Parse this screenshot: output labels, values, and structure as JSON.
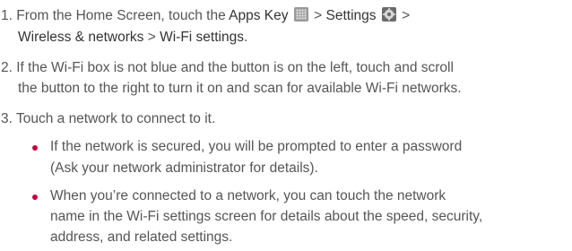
{
  "steps": [
    {
      "number": "1.",
      "line1_pre": "From the Home Screen, touch the ",
      "apps_key": "Apps Key",
      "sep1": " > ",
      "settings": "Settings",
      "sep2": " >",
      "wireless": "Wireless & networks",
      "sep3": " > ",
      "wifi_settings": "Wi-Fi settings",
      "end": "."
    },
    {
      "number": "2.",
      "line1": "If the Wi-Fi box is not blue and the button is on the left, touch and scroll",
      "line2": "the button to the right to turn it on and scan for available Wi-Fi networks."
    },
    {
      "number": "3.",
      "line1": "Touch a network to connect to it."
    }
  ],
  "bullets": [
    {
      "line1": "If the network is secured, you will be prompted to enter a password",
      "line2": "(Ask your network administrator for details)."
    },
    {
      "line1": "When you’re connected to a network, you can touch the network",
      "line2": "name in the Wi-Fi settings screen for details about the speed, security,",
      "line3": "address, and related settings."
    }
  ],
  "icons": {
    "apps": "apps-grid-icon",
    "settings": "settings-gear-icon",
    "bullet_color": "#c4003c"
  }
}
